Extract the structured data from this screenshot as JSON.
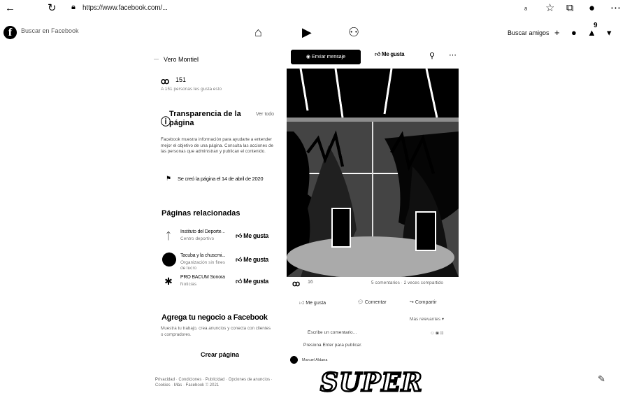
{
  "chrome": {
    "back_icon": "arrow-left-icon",
    "reload_icon": "reload-icon",
    "url": "https://www.facebook.com/..."
  },
  "fb_bar": {
    "search_placeholder": "Buscar en Facebook",
    "find_friends": "Buscar amigos",
    "notification_count": "9"
  },
  "left": {
    "owner": "Vero Montiel",
    "likes_count": "151",
    "likes_sub": "A 151 personas les gusta esto",
    "transparency_title": "Transparencia de la página",
    "see_all": "Ver todo",
    "transparency_desc": "Facebook muestra información para ayudarte a entender mejor el objetivo de una página. Consulta las acciones de las personas que administran y publican el contenido.",
    "created": "Se creó la página el 14 de abril de 2020",
    "related_title": "Páginas relacionadas",
    "related": [
      {
        "name": "Instituto del Deporte...",
        "sub": "Centro deportivo",
        "like": "Me gusta"
      },
      {
        "name": "Tacuba y la chuscmi...",
        "sub": "Organización sin fines de lucro",
        "like": "Me gusta"
      },
      {
        "name": "PRO BACUM Sonora",
        "sub": "Noticias",
        "like": "Me gusta"
      }
    ],
    "biz_title": "Agrega tu negocio a Facebook",
    "biz_desc": "Muestra tu trabajo, crea anuncios y conecta con clientes o compradores.",
    "create_page": "Crear página",
    "footer": "Privacidad · Condiciones · Publicidad · Opciones de anuncios · Cookies · Más · Facebook © 2021"
  },
  "right": {
    "send_message": "Enviar mensaje",
    "like_button": "Me gusta",
    "reactions_count": "16",
    "reactions_right": "5 comentarios · 2 veces compartido",
    "actions": [
      "Me gusta",
      "Comentar",
      "Compartir"
    ],
    "most_relevant": "Más relevantes ▾",
    "comment1": "Escribe un comentario...",
    "comment2": "Presiona Enter para publicar.",
    "commenter": "Manuel Aldana",
    "sticker_text": "SUPER"
  }
}
